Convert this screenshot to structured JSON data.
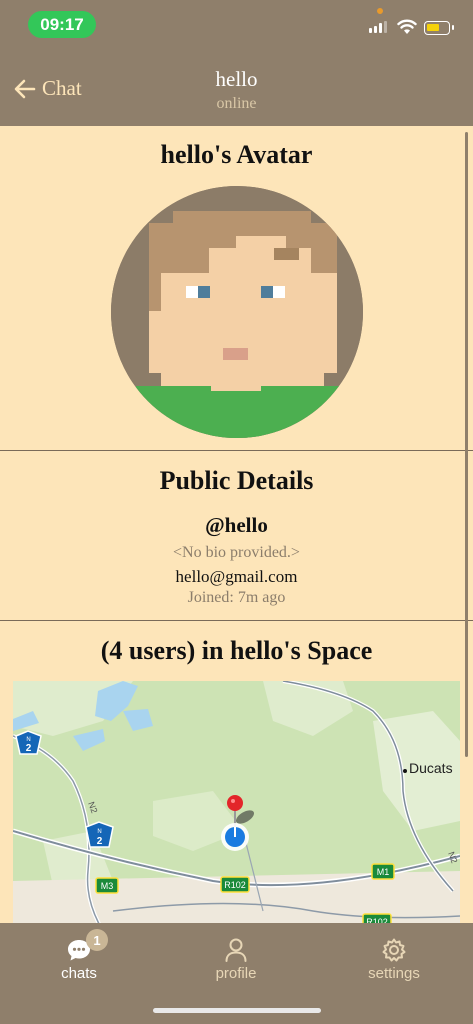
{
  "status_bar": {
    "time": "09:17"
  },
  "nav": {
    "back_label": "Chat",
    "title": "hello",
    "subtitle": "online"
  },
  "avatar_section": {
    "title": "hello's Avatar"
  },
  "details": {
    "title": "Public Details",
    "handle": "@hello",
    "bio": "<No bio provided.>",
    "email": "hello@gmail.com",
    "joined": "Joined: 7m ago"
  },
  "space": {
    "title": "(4 users) in hello's Space",
    "map_labels": {
      "n2_shield": "2",
      "n2_shield_small": "N",
      "n2_road": "N2",
      "m3": "M3",
      "r102": "R102",
      "m1": "M1",
      "ducats": "Ducats"
    }
  },
  "tabs": [
    {
      "label": "chats",
      "icon": "chat-bubble-icon",
      "badge": "1",
      "active": true
    },
    {
      "label": "profile",
      "icon": "person-icon",
      "active": false
    },
    {
      "label": "settings",
      "icon": "gear-icon",
      "active": false
    }
  ],
  "colors": {
    "header_bg": "#8f7f6b",
    "content_bg": "#fde5b9",
    "accent": "#33c759"
  }
}
